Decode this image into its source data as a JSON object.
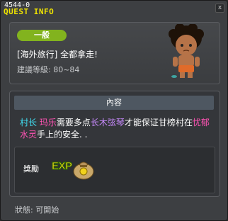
{
  "window": {
    "quest_id": "4544-0",
    "title": "QUEST INFO",
    "close_label": "x"
  },
  "header": {
    "category": "一般",
    "quest_name": "[海外旅行] 全都拿走!",
    "level_requirement": "建議等級: 80~84",
    "npc_portrait": "npc-portrait-icon"
  },
  "content": {
    "header_label": "內容",
    "description": [
      {
        "text": "村长 ",
        "color": "cyan"
      },
      {
        "text": "玛乐",
        "color": "pink"
      },
      {
        "text": "需要多点",
        "color": "white"
      },
      {
        "text": "长木弦琴",
        "color": "purple"
      },
      {
        "text": "才能保证甘榜村在",
        "color": "white"
      },
      {
        "text": "忧郁水灵",
        "color": "pink"
      },
      {
        "text": "手上的安全. .",
        "color": "white"
      }
    ],
    "reward": {
      "label": "獎勵",
      "exp_label": "EXP",
      "bag_icon": "money-bag-icon"
    }
  },
  "status": {
    "text": "狀態: 可開始"
  }
}
